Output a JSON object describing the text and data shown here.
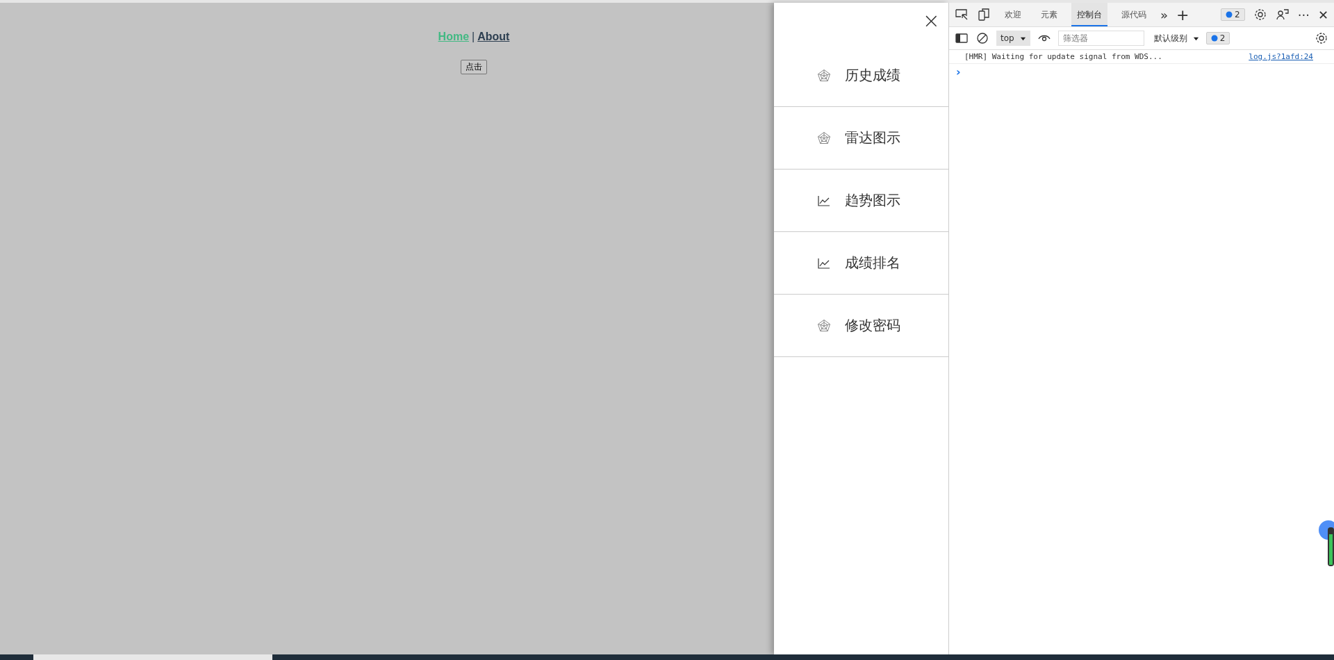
{
  "page": {
    "nav": [
      {
        "label": "Home",
        "selected": true
      },
      {
        "label": "About",
        "selected": false
      }
    ],
    "nav_separator": "|",
    "button": "点击"
  },
  "drawer": {
    "close": "×",
    "items": [
      {
        "label": "历史成绩",
        "kind": "radar"
      },
      {
        "label": "雷达图示",
        "kind": "radar"
      },
      {
        "label": "趋势图示",
        "kind": "line"
      },
      {
        "label": "成绩排名",
        "kind": "line"
      },
      {
        "label": "修改密码",
        "kind": "radar"
      }
    ]
  },
  "devtools": {
    "tabs": [
      {
        "label": "欢迎",
        "selected": false
      },
      {
        "label": "元素",
        "selected": false
      },
      {
        "label": "控制台",
        "selected": true
      },
      {
        "label": "源代码",
        "selected": false
      }
    ],
    "more": "»",
    "add": "+",
    "issues_count": "2",
    "more_menu": "···",
    "close": "✕",
    "context": "top",
    "filter": {
      "placeholder": "筛选器"
    },
    "level": "默认级别",
    "toolbar_issues_count": "2",
    "messages": [
      {
        "text": "[HMR] Waiting for update signal from WDS...",
        "source": "log.js?1afd:24"
      }
    ],
    "prompt": "›"
  }
}
